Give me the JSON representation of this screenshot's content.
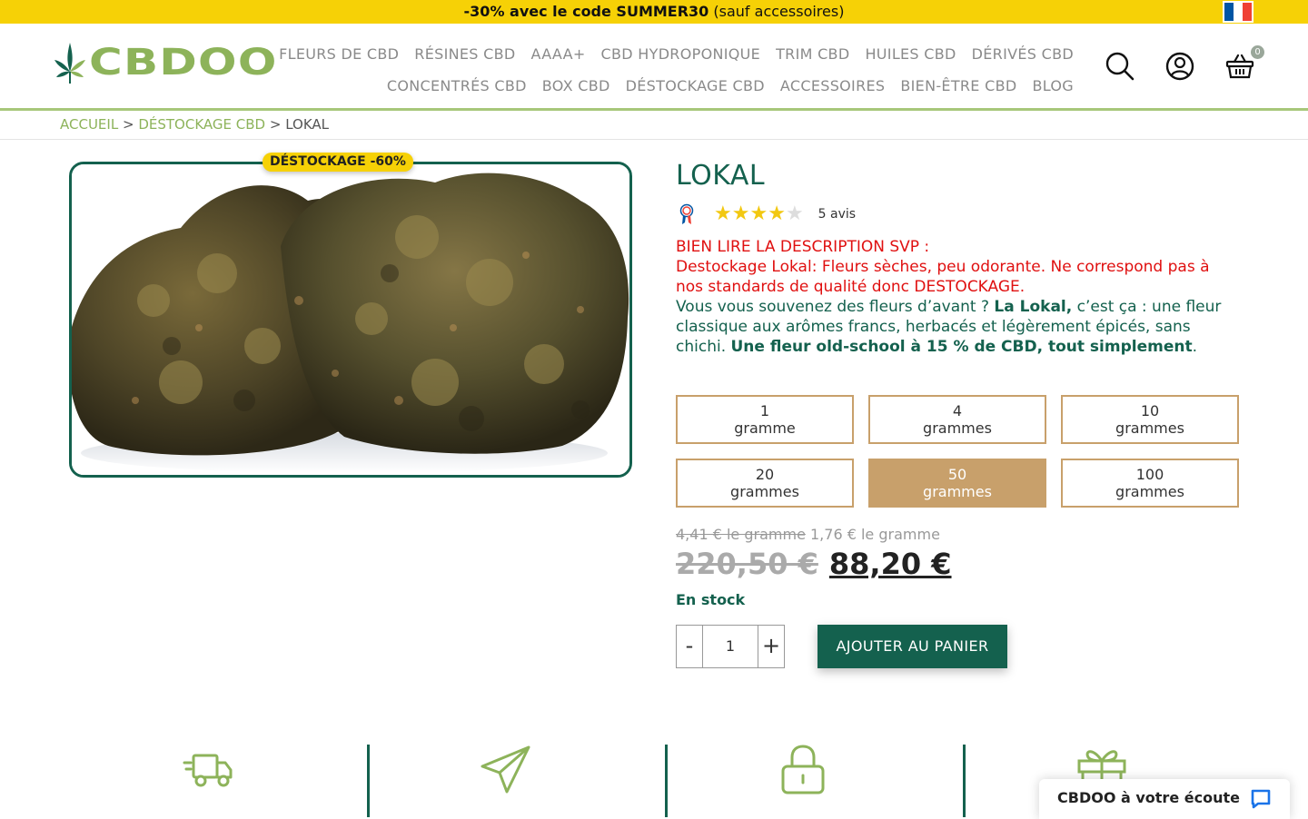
{
  "promo": {
    "prefix": "  ",
    "code_text": "-30% avec le code SUMMER30",
    "suffix": " (sauf accessoires)",
    "emoji_left": "",
    "emoji_right": ""
  },
  "flag": {
    "colors": [
      "#0055a4",
      "#ffffff",
      "#ef4135"
    ]
  },
  "logo": {
    "text": "CBDOO",
    "color": "#8db35a"
  },
  "nav": {
    "row1": [
      "FLEURS DE CBD",
      "RÉSINES CBD",
      "AAAA+",
      "CBD HYDROPONIQUE",
      "TRIM CBD",
      "HUILES CBD",
      "DÉRIVÉS CBD"
    ],
    "row2": [
      "CONCENTRÉS CBD",
      "BOX CBD",
      "DÉSTOCKAGE CBD",
      "ACCESSOIRES",
      "BIEN-ÊTRE CBD",
      "BLOG"
    ]
  },
  "header_icons": {
    "search": "search-icon",
    "account": "user-icon",
    "cart": "basket-icon",
    "cart_count": "0"
  },
  "breadcrumb": {
    "home": "ACCUEIL",
    "sep": ">",
    "category": "DÉSTOCKAGE CBD",
    "current": "LOKAL"
  },
  "badge": {
    "text": " DÉSTOCKAGE -60% "
  },
  "product": {
    "title": "LOKAL",
    "rating": 4,
    "rating_max": 5,
    "reviews": "5 avis",
    "desc_warn_1": "BIEN LIRE LA DESCRIPTION SVP :",
    "desc_warn_2": "Destockage Lokal: Fleurs sèches, peu odorante. Ne correspond pas à nos standards de qualité donc DESTOCKAGE.",
    "desc_p1": "Vous vous souvenez des fleurs d’avant ? ",
    "desc_b1": "La Lokal,",
    "desc_p2": " c’est ça : une fleur classique aux arômes francs, herbacés et légèrement épicés, sans chichi. ",
    "desc_b2": "Une fleur old-school à 15 % de CBD, tout simplement",
    "desc_p3": "."
  },
  "variants": [
    {
      "qty": "1",
      "unit": "gramme",
      "selected": false
    },
    {
      "qty": "4",
      "unit": "grammes",
      "selected": false
    },
    {
      "qty": "10",
      "unit": "grammes",
      "selected": false
    },
    {
      "qty": "20",
      "unit": "grammes",
      "selected": false
    },
    {
      "qty": "50",
      "unit": "grammes",
      "selected": true
    },
    {
      "qty": "100",
      "unit": "grammes",
      "selected": false
    }
  ],
  "pricing": {
    "unit_old": "4,41 € le gramme",
    "unit_new": "1,76 € le gramme",
    "old_price": "220,50 €",
    "new_price": "88,20 €",
    "stock": "En stock"
  },
  "cart": {
    "minus": "-",
    "quantity": "1",
    "plus": "+",
    "add_label": "AJOUTER AU PANIER"
  },
  "features": [
    "truck-icon",
    "paper-plane-icon",
    "lock-icon",
    "gift-icon"
  ],
  "chat": {
    "label": "CBDOO à votre écoute"
  },
  "colors": {
    "brand_green": "#14614e",
    "light_green": "#8db35a",
    "gold": "#c8a06b",
    "promo_yellow": "#f6d106",
    "warn_red": "#e01010"
  }
}
